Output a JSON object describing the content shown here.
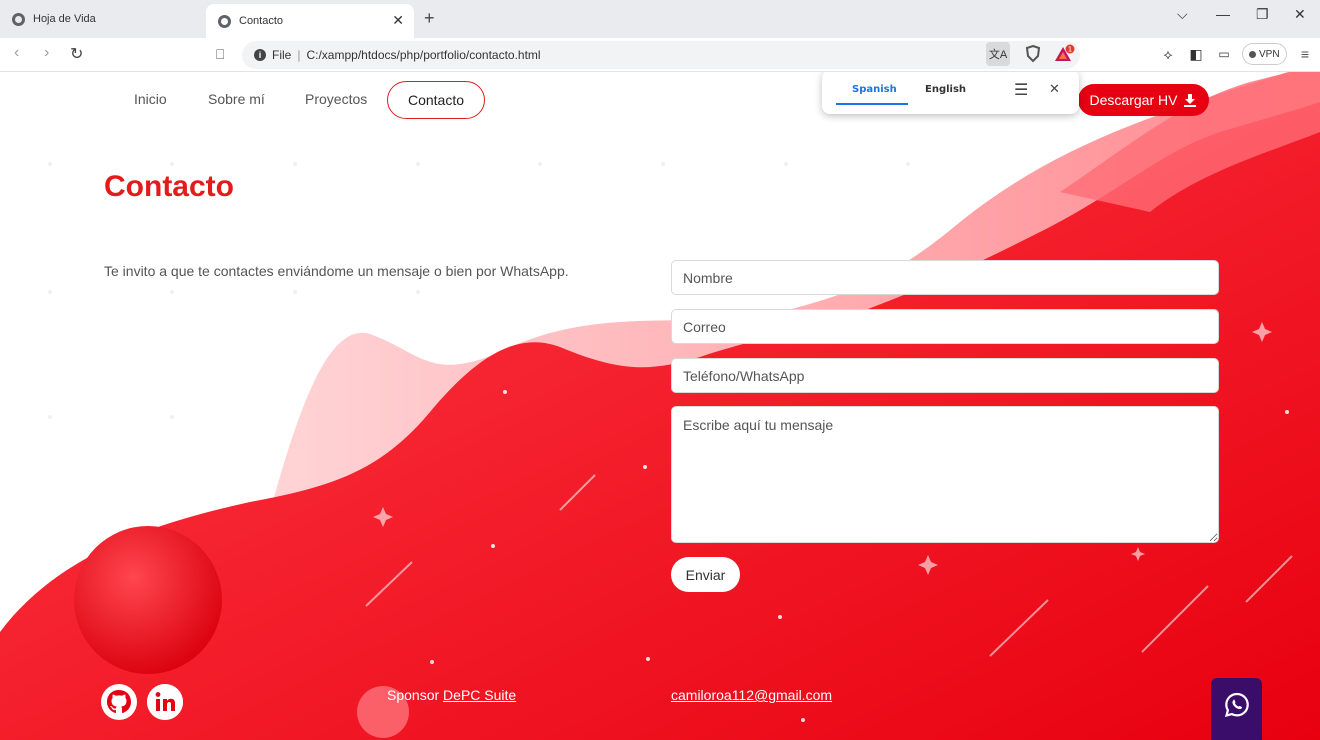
{
  "browser": {
    "tabs": [
      {
        "label": "Hoja de Vida",
        "active": false
      },
      {
        "label": "Contacto",
        "active": true
      }
    ],
    "address": {
      "scheme": "File",
      "url": "C:/xampp/htdocs/php/portfolio/contacto.html"
    },
    "vpn_label": "VPN",
    "shield_badge": "1"
  },
  "translate_popup": {
    "source_language": "Spanish",
    "target_language": "English"
  },
  "nav": {
    "items": [
      "Inicio",
      "Sobre mí",
      "Proyectos",
      "Contacto"
    ],
    "active": "Contacto",
    "download_label": "Descargar HV"
  },
  "contact": {
    "title": "Contacto",
    "intro": "Te invito a que te contactes enviándome un mensaje o bien por WhatsApp.",
    "form": {
      "name_placeholder": "Nombre",
      "email_placeholder": "Correo",
      "phone_placeholder": "Teléfono/WhatsApp",
      "message_placeholder": "Escribe aquí tu mensaje",
      "submit_label": "Enviar"
    }
  },
  "footer": {
    "sponsor_prefix": "Sponsor",
    "sponsor_link": "DePC Suite",
    "email": "camiloroa112@gmail.com"
  },
  "colors": {
    "accent": "#e60012",
    "title": "#e31b1b",
    "whatsapp_button": "#3b0d6b"
  },
  "icons": [
    "github-icon",
    "linkedin-icon",
    "whatsapp-icon",
    "download-icon"
  ]
}
